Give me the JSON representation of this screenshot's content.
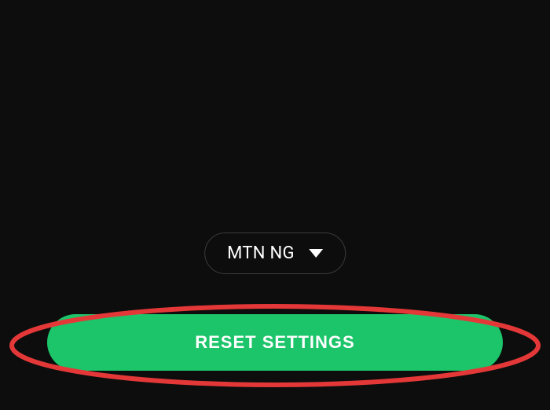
{
  "dropdown": {
    "selected": "MTN NG"
  },
  "button": {
    "reset_label": "RESET SETTINGS"
  },
  "colors": {
    "background": "#0d0d0d",
    "accent": "#1cc46a",
    "annotation": "#e43838"
  }
}
